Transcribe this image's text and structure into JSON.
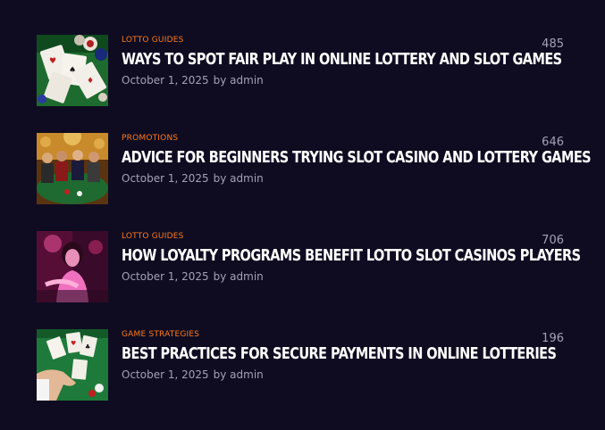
{
  "posts": [
    {
      "category": "LOTTO GUIDES",
      "title": "WAYS TO SPOT FAIR PLAY IN ONLINE LOTTERY AND SLOT GAMES",
      "date": "October 1, 2025",
      "author": "by admin",
      "views": "485",
      "thumbnail": "playing-cards-and-chips"
    },
    {
      "category": "PROMOTIONS",
      "title": "ADVICE FOR BEGINNERS TRYING SLOT CASINO AND LOTTERY GAMES",
      "date": "October 1, 2025",
      "author": "by admin",
      "views": "646",
      "thumbnail": "people-at-casino-table"
    },
    {
      "category": "LOTTO GUIDES",
      "title": "HOW LOYALTY PROGRAMS BENEFIT LOTTO SLOT CASINOS PLAYERS",
      "date": "October 1, 2025",
      "author": "by admin",
      "views": "706",
      "thumbnail": "woman-in-neon-light"
    },
    {
      "category": "GAME STRATEGIES",
      "title": "BEST PRACTICES FOR SECURE PAYMENTS IN ONLINE LOTTERIES",
      "date": "October 1, 2025",
      "author": "by admin",
      "views": "196",
      "thumbnail": "hand-dealing-cards"
    }
  ],
  "colors": {
    "background": "#0f0c22",
    "category": "#ff7a1a",
    "title": "#ffffff",
    "meta": "#a4a0b6"
  }
}
